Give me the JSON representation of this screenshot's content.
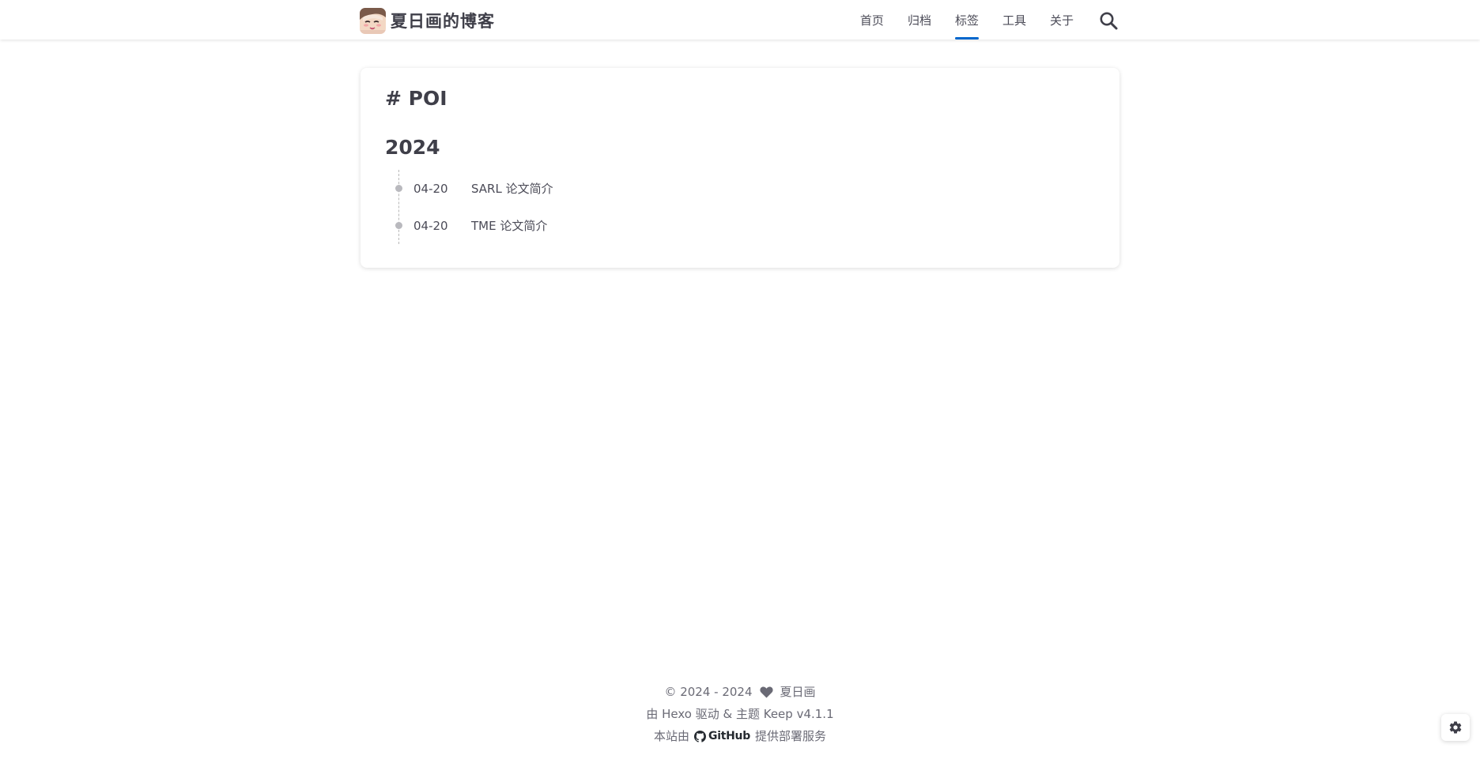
{
  "header": {
    "site_title": "夏日画的博客",
    "nav": [
      {
        "label": "首页",
        "active": false
      },
      {
        "label": "归档",
        "active": false
      },
      {
        "label": "标签",
        "active": true
      },
      {
        "label": "工具",
        "active": false
      },
      {
        "label": "关于",
        "active": false
      }
    ],
    "search_icon": "search-icon",
    "accent_color": "#0066cc"
  },
  "main": {
    "tag_title": "# POI",
    "year": "2024",
    "posts": [
      {
        "date": "04-20",
        "title": "SARL 论文简介"
      },
      {
        "date": "04-20",
        "title": "TME 论文简介"
      }
    ]
  },
  "footer": {
    "copyright_prefix": "© 2024 - 2024",
    "author": "夏日画",
    "powered": "由 Hexo 驱动 & 主题 Keep v4.1.1",
    "host_prefix": "本站由",
    "host_name": "GitHub",
    "host_suffix": "提供部署服务"
  },
  "settings_icon": "gear-icon"
}
